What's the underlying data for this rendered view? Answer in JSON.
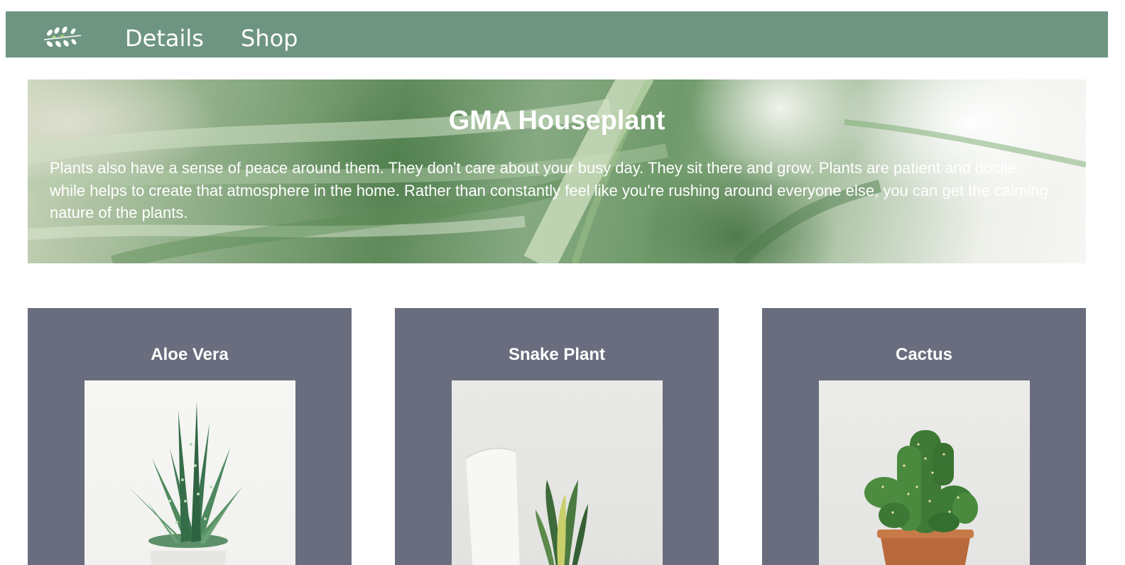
{
  "nav": {
    "logo_icon": "leaf-branch-icon",
    "links": [
      {
        "label": "Details"
      },
      {
        "label": "Shop"
      }
    ],
    "background_color": "#6e9582"
  },
  "hero": {
    "title": "GMA Houseplant",
    "text": "Plants also have a sense of peace around them. They don't care about your busy day. They sit there and grow. Plants are patient and docile, while helps to create that atmosphere in the home. Rather than constantly feel like you're rushing around everyone else, you can get the calming nature of the plants."
  },
  "cards": [
    {
      "title": "Aloe Vera",
      "image_icon": "aloe-vera-plant-icon"
    },
    {
      "title": "Snake Plant",
      "image_icon": "snake-plant-icon"
    },
    {
      "title": "Cactus",
      "image_icon": "cactus-plant-icon"
    }
  ],
  "colors": {
    "card_background": "#6a6d7e",
    "text": "#ffffff"
  }
}
